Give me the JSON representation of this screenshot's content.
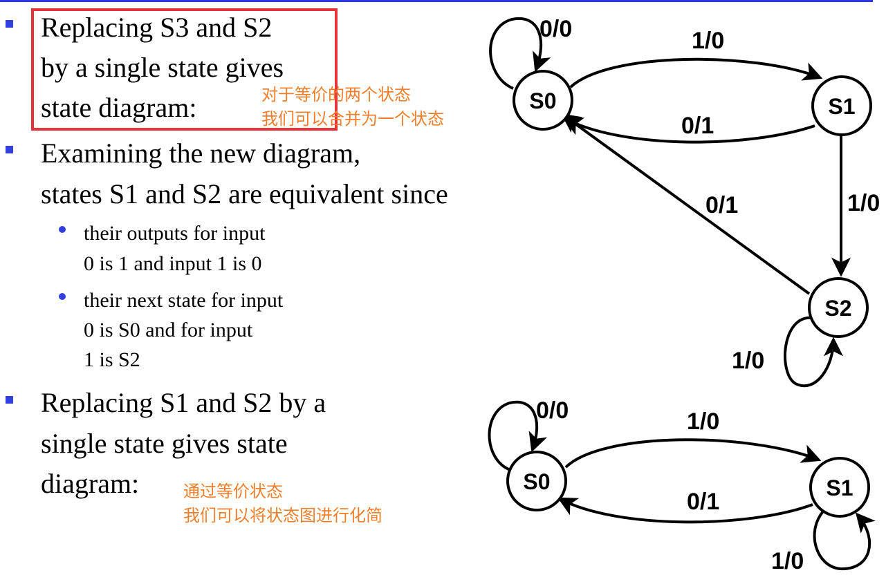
{
  "bullets": [
    {
      "lines": [
        "Replacing S3 and S2",
        "by a single state gives",
        "state diagram:"
      ]
    },
    {
      "lines": [
        "Examining the new diagram,",
        "states S1 and S2 are equivalent since"
      ]
    },
    {
      "lines": [
        "Replacing S1 and S2 by a",
        "single state gives state",
        "diagram:"
      ]
    }
  ],
  "sub_bullets": [
    {
      "lines": [
        "their outputs for input",
        "0 is 1 and input 1 is 0"
      ]
    },
    {
      "lines": [
        "their next state for input",
        "0 is S0 and for input",
        "1 is  S2"
      ]
    }
  ],
  "annotations": {
    "note1": [
      "对于等价的两个状态",
      "我们可以合并为一个状态"
    ],
    "note2": [
      "通过等价状态",
      "我们可以将状态图进行化简"
    ]
  },
  "diagram_top": {
    "nodes": [
      "S0",
      "S1",
      "S2"
    ],
    "edges": {
      "s0_self": "0/0",
      "s0_to_s1": "1/0",
      "s1_to_s0": "0/1",
      "s1_to_s2": "1/0",
      "s2_to_s0": "0/1",
      "s2_self": "1/0"
    }
  },
  "diagram_bottom": {
    "nodes": [
      "S0",
      "S1"
    ],
    "edges": {
      "s0_self": "0/0",
      "s0_to_s1": "1/0",
      "s1_to_s0": "0/1",
      "s1_self": "1/0"
    }
  },
  "colors": {
    "bullet": "#3340e0",
    "top_rule": "#2b36e8",
    "highlight_box": "#e8333a",
    "annotation": "#f07f2d"
  }
}
